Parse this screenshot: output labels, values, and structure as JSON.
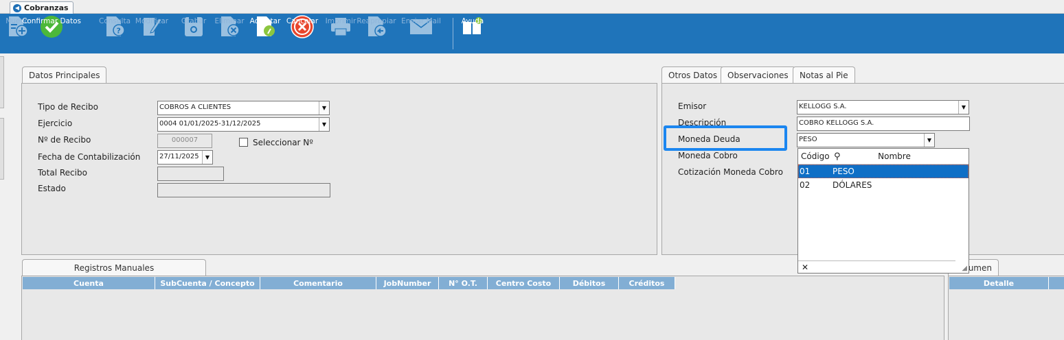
{
  "app_tab": {
    "label": "Cobranzas"
  },
  "toolbar": {
    "nuevo": "Nuevo",
    "confirmar": "Confirmar Datos",
    "consulta": "Consulta",
    "modificar": "Modificar",
    "grabar": "Grabar",
    "eliminar": "Eliminar",
    "adjuntar": "Adjuntar",
    "cancelar": "Cancelar",
    "imprimir": "Imprimir",
    "reapropiar": "Reapropiar",
    "enviar_mail": "Enviar Mail",
    "ayuda": "Ayuda"
  },
  "principales": {
    "tab": "Datos Principales",
    "tipo_label": "Tipo de Recibo",
    "tipo_value": "COBROS A CLIENTES",
    "ejercicio_label": "Ejercicio",
    "ejercicio_value": "0004 01/01/2025-31/12/2025",
    "nro_label": "Nº de Recibo",
    "nro_value": "000007",
    "seleccionar_label": "Seleccionar Nº",
    "fecha_label": "Fecha de Contabilización",
    "fecha_value": "27/11/2025",
    "total_label": "Total Recibo",
    "total_value": "",
    "estado_label": "Estado",
    "estado_value": ""
  },
  "otros": {
    "tabs": [
      "Otros Datos",
      "Observaciones",
      "Notas al Pie"
    ],
    "emisor_label": "Emisor",
    "emisor_value": "KELLOGG S.A.",
    "descripcion_label": "Descripción",
    "descripcion_value": "COBRO KELLOGG S.A.",
    "moneda_deuda_label": "Moneda Deuda",
    "moneda_deuda_value": "PESO",
    "moneda_cobro_label": "Moneda Cobro",
    "cotizacion_label": "Cotización Moneda Cobro"
  },
  "dropdown": {
    "col_codigo": "Código",
    "col_nombre": "Nombre",
    "rows": [
      {
        "codigo": "01",
        "nombre": "PESO"
      },
      {
        "codigo": "02",
        "nombre": "DÓLARES"
      }
    ],
    "close": "✕"
  },
  "registros": {
    "tab": "Registros Manuales",
    "columns": [
      "Cuenta",
      "SubCuenta / Concepto",
      "Comentario",
      "JobNumber",
      "N° O.T.",
      "Centro Costo",
      "Débitos",
      "Créditos"
    ]
  },
  "resumen": {
    "tab_partial": "umen",
    "columns": [
      "Detalle"
    ]
  }
}
